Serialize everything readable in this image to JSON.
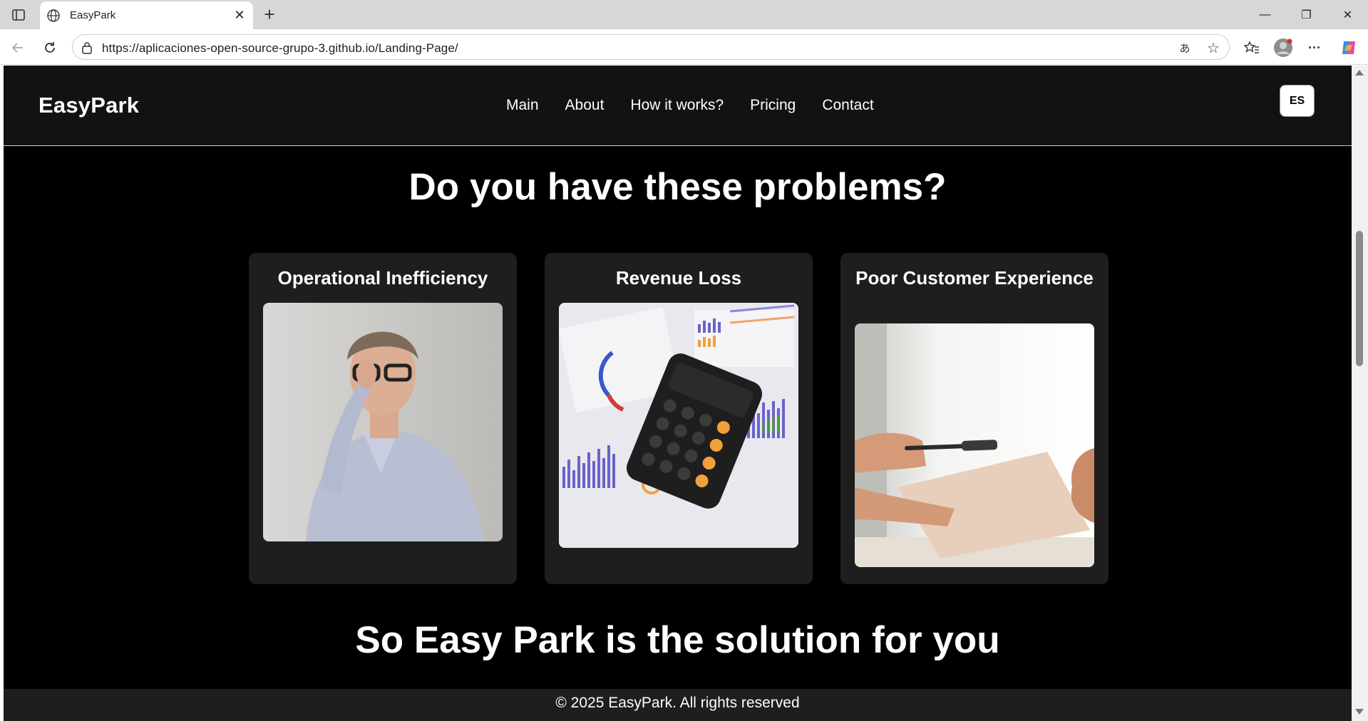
{
  "browser": {
    "tab_title": "EasyPark",
    "url": "https://aplicaciones-open-source-grupo-3.github.io/Landing-Page/",
    "icons": {
      "tab_menu": "sidebar-icon",
      "tab_favicon": "globe-icon",
      "tab_close": "close-icon",
      "new_tab": "plus-icon",
      "back": "arrow-left-icon",
      "reload": "reload-icon",
      "site_info": "lock-icon",
      "translate": "translate-icon",
      "favorite": "star-icon",
      "favorites": "favorites-icon",
      "profile": "profile-icon",
      "more": "more-icon",
      "copilot": "copilot-icon",
      "minimize": "minimize-icon",
      "restore": "restore-icon",
      "close_window": "close-icon"
    },
    "glyphs": {
      "close": "✕",
      "new_tab": "+",
      "minimize": "—",
      "restore": "❐",
      "close_window": "✕",
      "more": "···",
      "translate": "あ",
      "star": "☆"
    }
  },
  "site": {
    "brand": "EasyPark",
    "nav": [
      "Main",
      "About",
      "How it works?",
      "Pricing",
      "Contact"
    ],
    "language_button": "ES",
    "problems_title": "Do you have these problems?",
    "cards": [
      {
        "title": "Operational Inefficiency",
        "image": "stressed-man-photo"
      },
      {
        "title": "Revenue Loss",
        "image": "calculator-charts-photo"
      },
      {
        "title": "Poor Customer Experience",
        "image": "document-handover-photo"
      }
    ],
    "solution_title": "So Easy Park is the solution for you",
    "footer": "© 2025 EasyPark. All rights reserved"
  },
  "colors": {
    "page_bg": "#000000",
    "header_bg": "#121212",
    "card_bg": "#1e1e1e",
    "text": "#ffffff",
    "chart_orange": "#f2a03d",
    "chart_blue": "#5a4fc8"
  }
}
